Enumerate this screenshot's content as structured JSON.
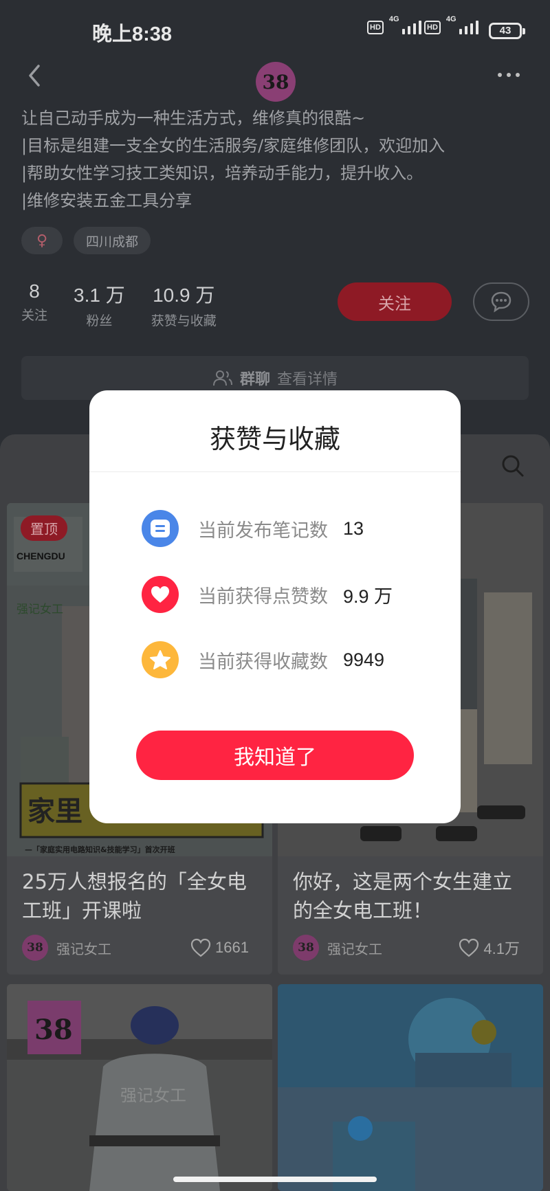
{
  "status_bar": {
    "time": "晚上8:38",
    "hd1": "HD",
    "net1": "4G",
    "hd2": "HD",
    "net2": "4G",
    "battery": "43"
  },
  "navbar": {
    "avatar_text": "38"
  },
  "profile": {
    "bio": [
      "让自己动手成为一种生活方式，维修真的很酷~",
      "|目标是组建一支全女的生活服务/家庭维修团队，欢迎加入",
      "|帮助女性学习技工类知识，培养动手能力，提升收入。",
      "|维修安装五金工具分享"
    ],
    "gender_symbol": "♀",
    "location": "四川成都",
    "stats": [
      {
        "num": "8",
        "label": "关注"
      },
      {
        "num": "3.1 万",
        "label": "粉丝"
      },
      {
        "num": "10.9 万",
        "label": "获赞与收藏"
      }
    ],
    "follow_label": "关注",
    "group": {
      "title": "群聊",
      "detail": "查看详情"
    }
  },
  "notes": [
    {
      "title_line1": "25万人想报名的「全女电",
      "title_line2": "工班」开课啦",
      "author": "强记女工",
      "likes": "1661",
      "pinned_label": "置顶",
      "cover_text": {
        "big": "家里",
        "sub": "CHENGDU",
        "tag": "强记女工",
        "caption": "—「家庭实用电路知识&技能学习」首次开班"
      }
    },
    {
      "title_line1": "你好，这是两个女生建立",
      "title_line2": "的全女电工班！",
      "author": "强记女工",
      "likes": "4.1万"
    }
  ],
  "modal": {
    "title": "获赞与收藏",
    "rows": [
      {
        "label": "当前发布笔记数",
        "value": "13",
        "color": "#4a86e8"
      },
      {
        "label": "当前获得点赞数",
        "value": "9.9 万",
        "color": "#ff2442"
      },
      {
        "label": "当前获得收藏数",
        "value": "9949",
        "color": "#fdb73b"
      }
    ],
    "button": "我知道了"
  }
}
